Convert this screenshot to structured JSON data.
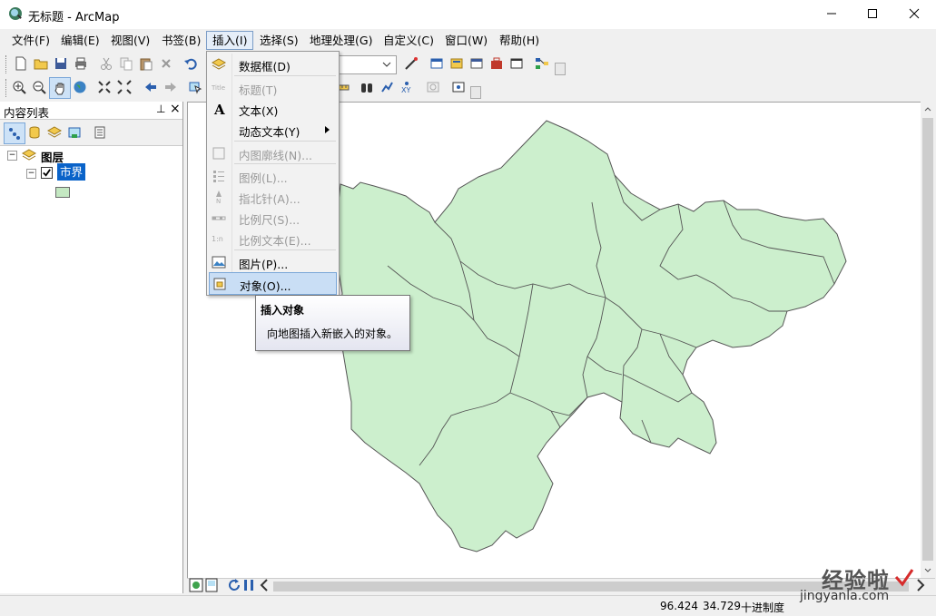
{
  "window": {
    "title": "无标题 - ArcMap"
  },
  "menubar": {
    "items": [
      "文件(F)",
      "编辑(E)",
      "视图(V)",
      "书签(B)",
      "插入(I)",
      "选择(S)",
      "地理处理(G)",
      "自定义(C)",
      "窗口(W)",
      "帮助(H)"
    ]
  },
  "insert_menu": {
    "items": [
      {
        "label": "数据框(D)",
        "icon": "data-frame-icon",
        "disabled": false
      },
      {
        "label": "标题(T)",
        "icon": "title-icon",
        "disabled": true
      },
      {
        "label": "文本(X)",
        "icon": "text-icon",
        "disabled": false
      },
      {
        "label": "动态文本(Y)",
        "icon": "",
        "disabled": false
      },
      {
        "label": "内图廓线(N)...",
        "icon": "neatline-icon",
        "disabled": true
      },
      {
        "label": "图例(L)...",
        "icon": "legend-icon",
        "disabled": true
      },
      {
        "label": "指北针(A)...",
        "icon": "north-arrow-icon",
        "disabled": true
      },
      {
        "label": "比例尺(S)...",
        "icon": "scale-bar-icon",
        "disabled": true
      },
      {
        "label": "比例文本(E)...",
        "icon": "scale-text-icon",
        "disabled": true
      },
      {
        "label": "图片(P)...",
        "icon": "picture-icon",
        "disabled": false
      },
      {
        "label": "对象(O)...",
        "icon": "object-icon",
        "disabled": false
      }
    ]
  },
  "tooltip": {
    "title": "插入对象",
    "body": "向地图插入新嵌入的对象。"
  },
  "toc": {
    "title": "内容列表",
    "pin_label": "⊥",
    "close_label": "×",
    "layers_label": "图层",
    "layer_name": "市界",
    "layer_symbol_color": "#c4e8c2"
  },
  "map": {
    "fill_color": "#ccefcd",
    "outline_color": "#555555"
  },
  "status": {
    "x": "96.424",
    "y": "34.729",
    "units": "十进制度"
  },
  "watermark": {
    "cn": "经验啦",
    "en": "jingyanla.com"
  },
  "colors": {
    "menu_highlight": "#c9def5",
    "selected_layer": "#0a63c9"
  }
}
